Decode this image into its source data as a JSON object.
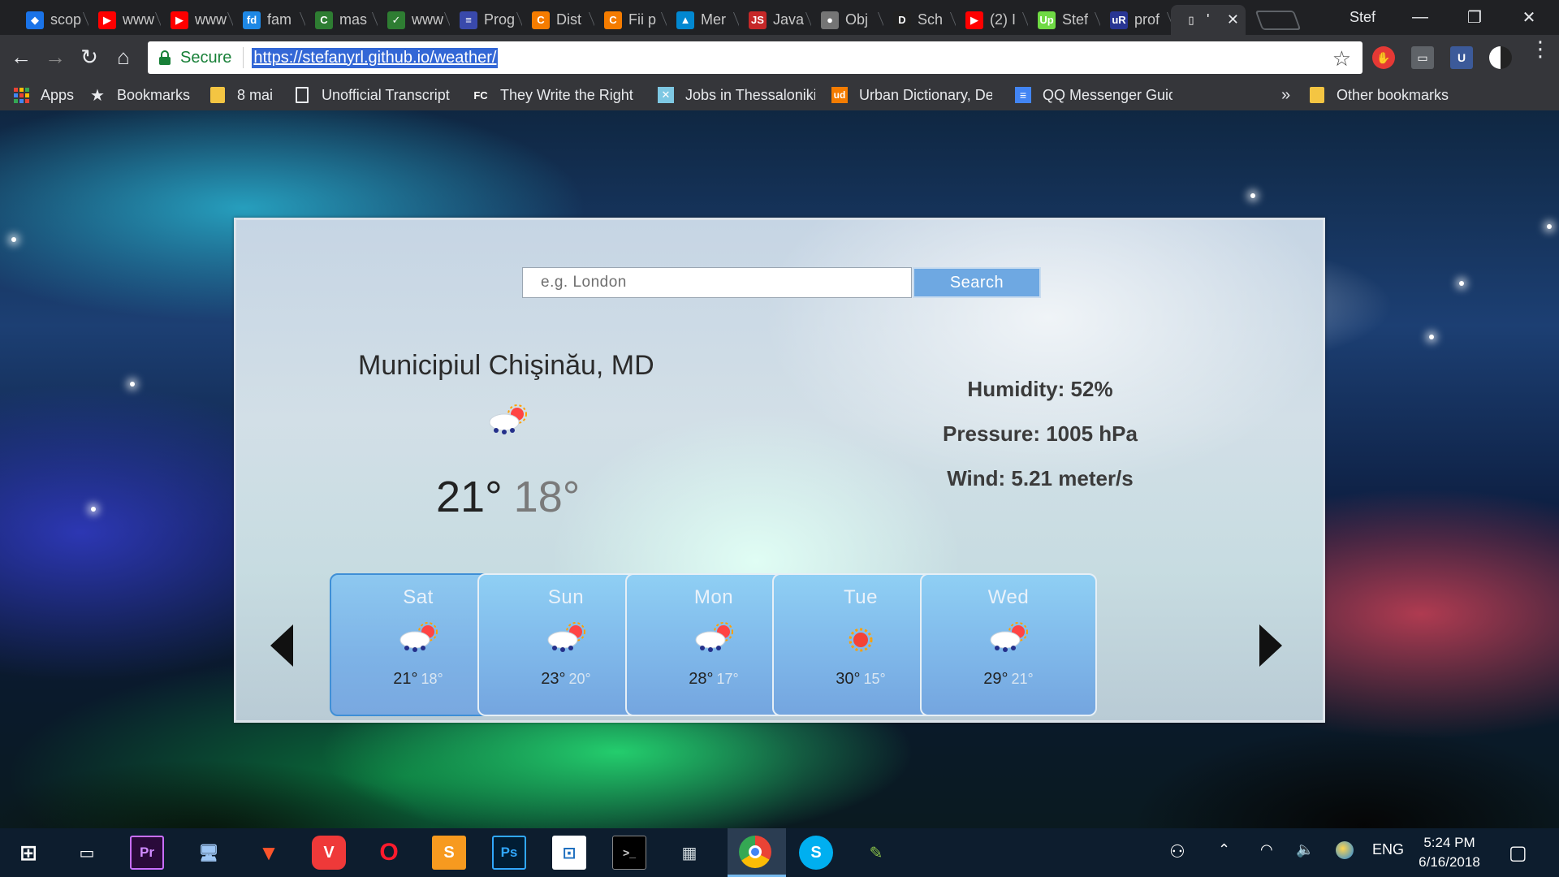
{
  "browser": {
    "tabs": [
      {
        "title": "scop",
        "favicon_color": "#1a73e8",
        "favicon_text": "◆"
      },
      {
        "title": "www",
        "favicon_color": "#ff0000",
        "favicon_text": "▶"
      },
      {
        "title": "www",
        "favicon_color": "#ff0000",
        "favicon_text": "▶"
      },
      {
        "title": "fam",
        "favicon_color": "#1e88e5",
        "favicon_text": "fd"
      },
      {
        "title": "mas",
        "favicon_color": "#2e7d32",
        "favicon_text": "C"
      },
      {
        "title": "www",
        "favicon_color": "#2e7d32",
        "favicon_text": "✓"
      },
      {
        "title": "Prog",
        "favicon_color": "#3949ab",
        "favicon_text": "≡"
      },
      {
        "title": "Dist",
        "favicon_color": "#f57c00",
        "favicon_text": "C"
      },
      {
        "title": "Fii p",
        "favicon_color": "#f57c00",
        "favicon_text": "C"
      },
      {
        "title": "Mer",
        "favicon_color": "#0288d1",
        "favicon_text": "▲"
      },
      {
        "title": "Java",
        "favicon_color": "#c62828",
        "favicon_text": "JS"
      },
      {
        "title": "Obj",
        "favicon_color": "#757575",
        "favicon_text": "●"
      },
      {
        "title": "Sch",
        "favicon_color": "#212121",
        "favicon_text": "D"
      },
      {
        "title": "(2) I",
        "favicon_color": "#ff0000",
        "favicon_text": "▶"
      },
      {
        "title": "Stef",
        "favicon_color": "#6fda44",
        "favicon_text": "Up"
      },
      {
        "title": "prof",
        "favicon_color": "#283593",
        "favicon_text": "uR"
      },
      {
        "title": "'",
        "favicon_color": "#35363a",
        "favicon_text": "▯",
        "active": true
      }
    ],
    "active_close": "✕",
    "profile_name": "Stef",
    "window_controls": {
      "minimize": "—",
      "restore": "❐",
      "close": "✕"
    },
    "nav": {
      "back": "←",
      "forward": "→",
      "reload": "↻",
      "home": "⌂"
    },
    "security_label": "Secure",
    "url": "https://stefanyrl.github.io/weather/",
    "bookmark_star": "☆",
    "bookmarks": [
      {
        "label": "Apps",
        "icon": "apps-icon"
      },
      {
        "label": "Bookmarks",
        "icon": "star-icon"
      },
      {
        "label": "8 mai",
        "icon": "folder-icon"
      },
      {
        "label": "Unofficial Transcript",
        "icon": "document-icon"
      },
      {
        "label": "They Write the Right",
        "icon": "fc-icon"
      },
      {
        "label": "Jobs in Thessaloniki,",
        "icon": "jobs-icon"
      },
      {
        "label": "Urban Dictionary, De",
        "icon": "ud-icon"
      },
      {
        "label": "QQ Messenger Guid",
        "icon": "docs-icon"
      }
    ],
    "more_bookmarks": "»",
    "other_bookmarks": "Other bookmarks"
  },
  "weather": {
    "search_placeholder": "e.g. London",
    "search_button": "Search",
    "city": "Municipiul Chişinău, MD",
    "current": {
      "high": "21°",
      "low": "18°",
      "icon": "rain-sun-icon"
    },
    "humidity": "Humidity: 52%",
    "pressure": "Pressure: 1005 hPa",
    "wind": "Wind: 5.21 meter/s",
    "forecast": [
      {
        "day": "Sat",
        "high": "21°",
        "low": "18°",
        "icon": "rain-sun-icon",
        "selected": true
      },
      {
        "day": "Sun",
        "high": "23°",
        "low": "20°",
        "icon": "rain-sun-icon"
      },
      {
        "day": "Mon",
        "high": "28°",
        "low": "17°",
        "icon": "rain-sun-icon"
      },
      {
        "day": "Tue",
        "high": "30°",
        "low": "15°",
        "icon": "sun-icon"
      },
      {
        "day": "Wed",
        "high": "29°",
        "low": "21°",
        "icon": "rain-sun-icon"
      }
    ]
  },
  "taskbar": {
    "apps": [
      "windows-start-icon",
      "task-view-icon",
      "premiere-icon",
      "remote-desktop-icon",
      "brave-icon",
      "vivaldi-icon",
      "opera-icon",
      "sublime-icon",
      "photoshop-icon",
      "sourcetree-icon",
      "terminal-icon",
      "screenshot-icon",
      "chrome-icon",
      "skype-icon",
      "notepad-icon"
    ],
    "language": "ENG",
    "time": "5:24 PM",
    "date": "6/16/2018"
  }
}
